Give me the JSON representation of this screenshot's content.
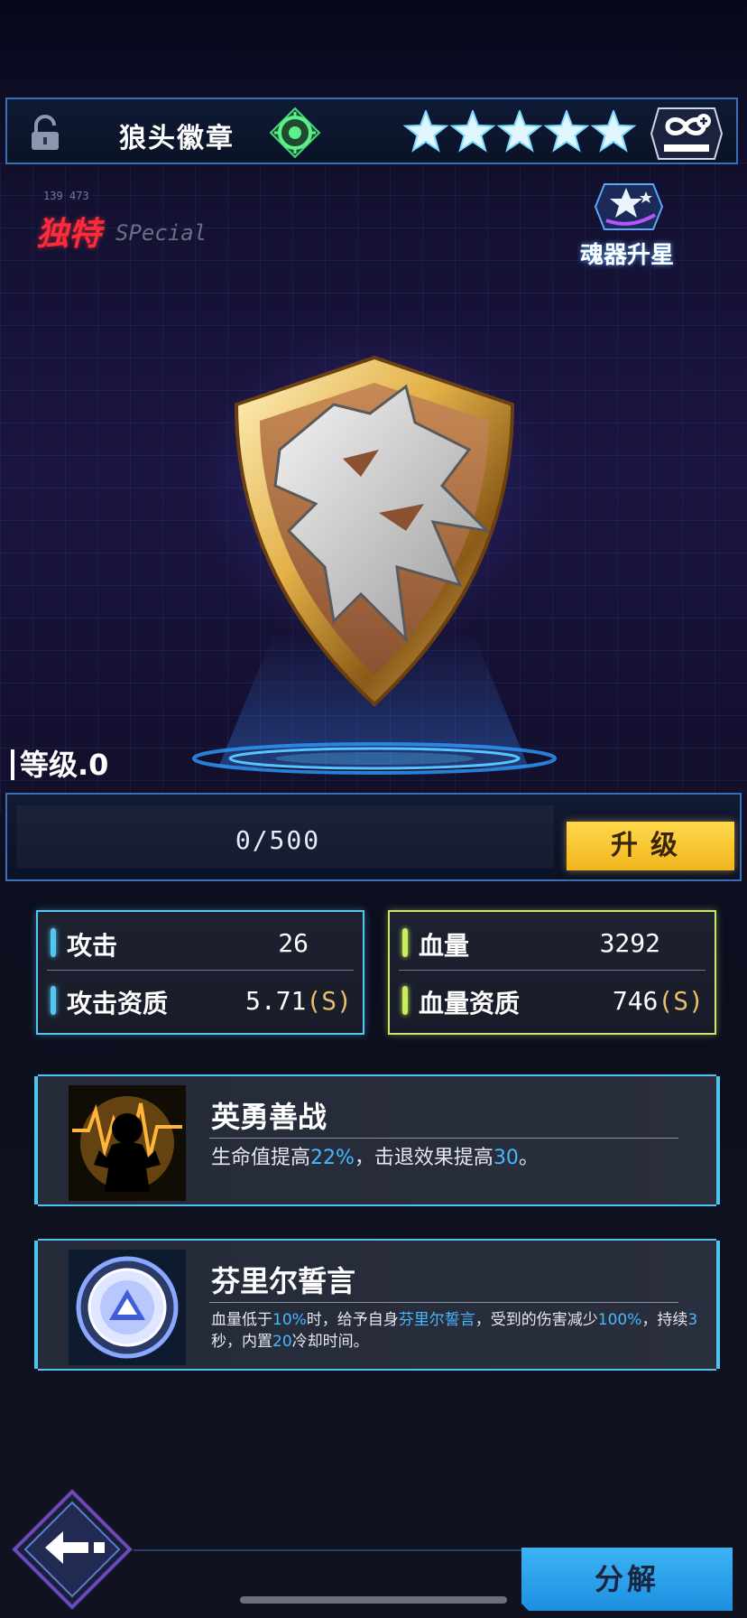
{
  "header": {
    "item_name": "狼头徽章",
    "star_count": 5,
    "star_max": 5
  },
  "tags": {
    "unique": "独特",
    "special": "SPecial",
    "readout": "139 473"
  },
  "upgrade_star": {
    "label": "魂器升星"
  },
  "level": {
    "label": "等级.0",
    "progress_text": "0/500",
    "progress_fraction": 0,
    "button": "升级"
  },
  "stats": {
    "attack": {
      "label": "攻击",
      "value": "26"
    },
    "attack_quality": {
      "label": "攻击资质",
      "value": "5.71",
      "grade": "(S)"
    },
    "hp": {
      "label": "血量",
      "value": "3292"
    },
    "hp_quality": {
      "label": "血量资质",
      "value": "746",
      "grade": "(S)"
    }
  },
  "skills": [
    {
      "title": "英勇善战",
      "desc": [
        {
          "t": "生命值提高"
        },
        {
          "t": "22%",
          "hl": true
        },
        {
          "t": "，击退效果提高"
        },
        {
          "t": "30",
          "hl": true
        },
        {
          "t": "。"
        }
      ]
    },
    {
      "title": "芬里尔誓言",
      "desc": [
        {
          "t": "血量低于"
        },
        {
          "t": "10%",
          "hl": true
        },
        {
          "t": "时，给予自身"
        },
        {
          "t": "芬里尔誓言",
          "hl": true
        },
        {
          "t": "，受到的伤害减少"
        },
        {
          "t": "100%",
          "hl": true
        },
        {
          "t": "，持续"
        },
        {
          "t": "3",
          "hl": true
        },
        {
          "t": "秒，内置"
        },
        {
          "t": "20",
          "hl": true
        },
        {
          "t": "冷却时间。"
        }
      ]
    }
  ],
  "bottom": {
    "disassemble": "分解"
  },
  "colors": {
    "accent_blue": "#46b8ff",
    "attack_border": "#55c8f0",
    "hp_border": "#c8e86a",
    "button_yellow": "#ffd84a",
    "unique_red": "#ff2a3a"
  },
  "icons": {
    "lock": "lock-icon",
    "target": "target-icon",
    "star": "star-icon",
    "infinity": "infinity-plus-icon",
    "upgrade_star": "star-upgrade-icon",
    "back": "back-arrow-icon",
    "skill1": "warrior-silhouette-icon",
    "skill2": "shield-emblem-icon"
  }
}
